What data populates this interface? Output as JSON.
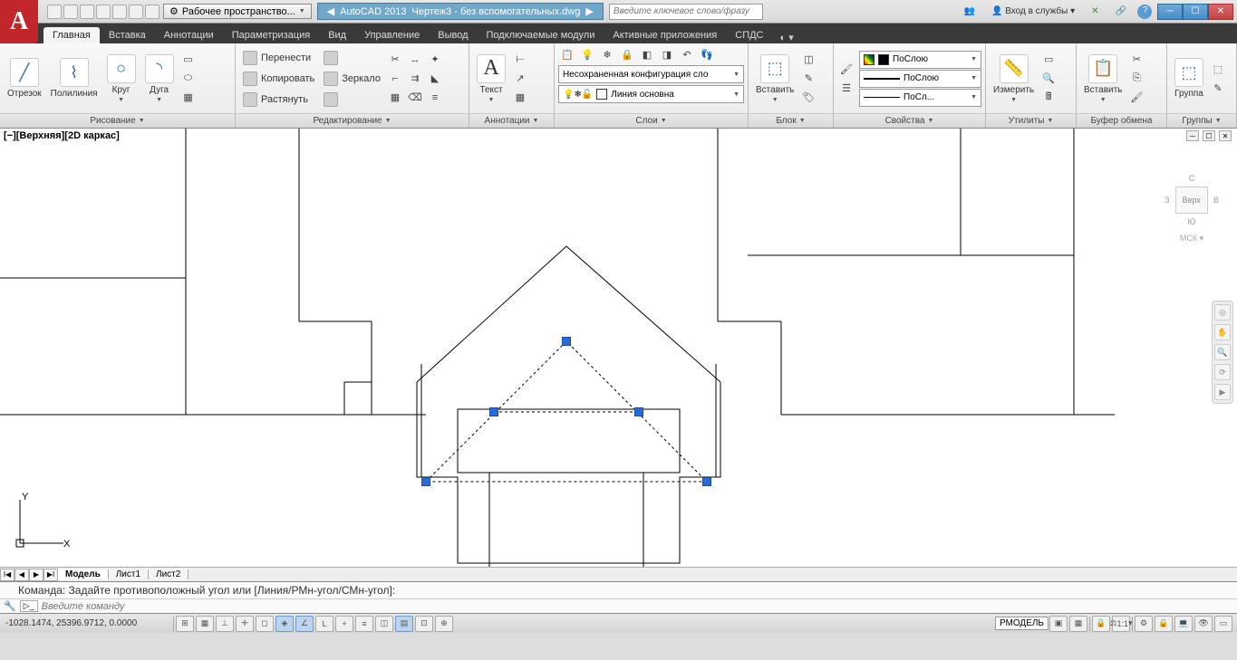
{
  "titlebar": {
    "workspace": "Рабочее пространство...",
    "app": "AutoCAD 2013",
    "file": "Чертеж3 - без вспомогательных.dwg",
    "search_placeholder": "Введите ключевое слово/фразу",
    "signin": "Вход в службы",
    "help": "?"
  },
  "ribbon": {
    "tabs": [
      "Главная",
      "Вставка",
      "Аннотации",
      "Параметризация",
      "Вид",
      "Управление",
      "Вывод",
      "Подключаемые модули",
      "Активные приложения",
      "СПДС"
    ],
    "panels": {
      "draw": {
        "title": "Рисование",
        "line": "Отрезок",
        "polyline": "Полилиния",
        "circle": "Круг",
        "arc": "Дуга"
      },
      "modify": {
        "title": "Редактирование",
        "move": "Перенести",
        "copy": "Копировать",
        "stretch": "Растянуть",
        "mirror": "Зеркало"
      },
      "annot": {
        "title": "Аннотации",
        "text": "Текст"
      },
      "layers": {
        "title": "Слои",
        "config": "Несохраненная конфигурация сло",
        "current": "Линия основна"
      },
      "block": {
        "title": "Блок",
        "insert": "Вставить"
      },
      "props": {
        "title": "Свойства",
        "color": "ПоСлою",
        "ltype": "ПоСлою",
        "lweight": "ПоСл..."
      },
      "util": {
        "title": "Утилиты",
        "measure": "Измерить"
      },
      "clip": {
        "title": "Буфер обмена",
        "paste": "Вставить"
      },
      "groups": {
        "title": "Группы",
        "group": "Группа"
      }
    }
  },
  "view": {
    "label": "[−][Верхняя][2D каркас]",
    "cube_top": "Верх",
    "cube_n": "С",
    "cube_s": "Ю",
    "cube_e": "В",
    "cube_w": "З",
    "wcs": "МСК"
  },
  "layout": {
    "tabs": [
      "Модель",
      "Лист1",
      "Лист2"
    ]
  },
  "command": {
    "history": "Команда: Задайте противоположный угол или [Линия/РМн-угол/СМн-угол]:",
    "placeholder": "Введите команду"
  },
  "status": {
    "coords": "-1028.1474, 25396.9712, 0.0000",
    "model": "РМОДЕЛЬ",
    "scale": "1:1"
  }
}
